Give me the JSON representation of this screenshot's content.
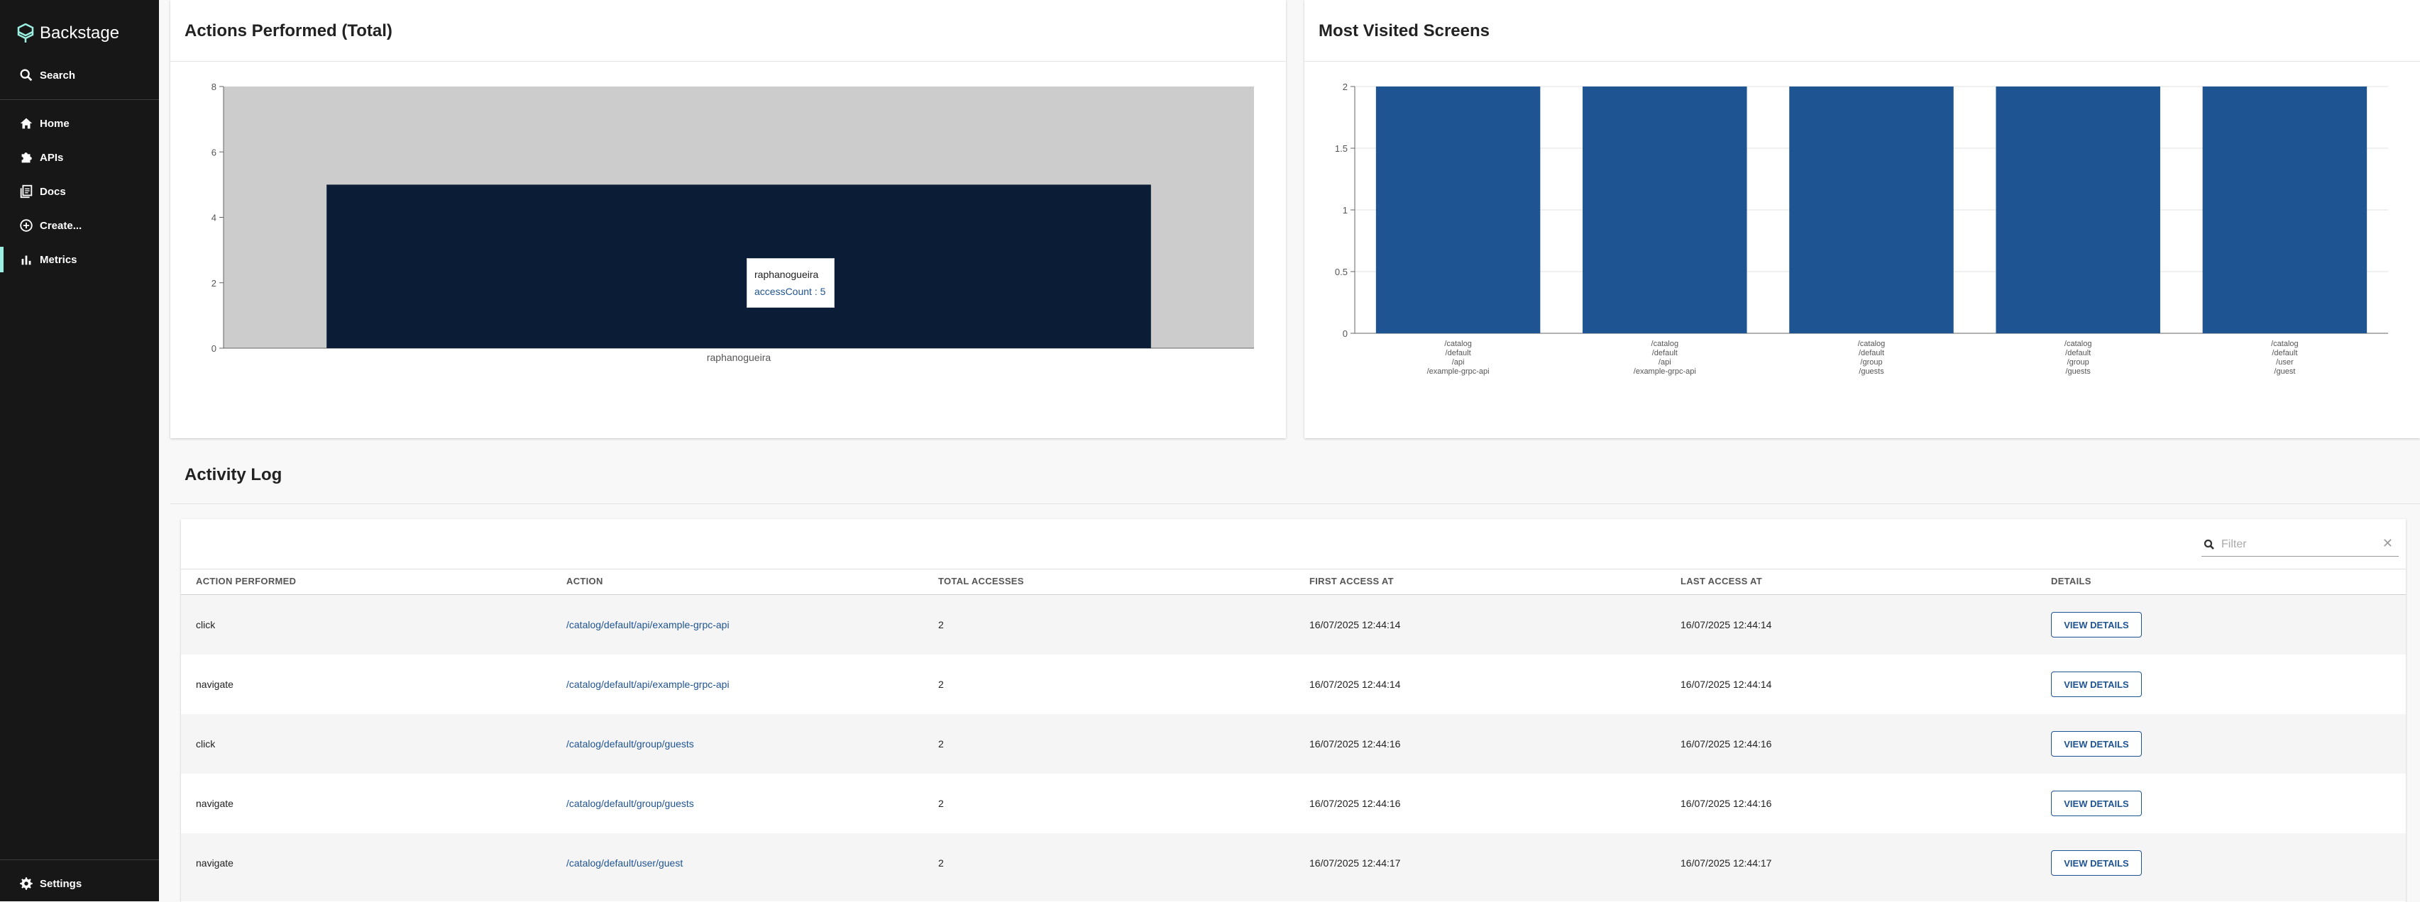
{
  "sidebar": {
    "logo_text": "Backstage",
    "items": [
      {
        "label": "Search",
        "icon": "search-icon"
      },
      {
        "label": "Home",
        "icon": "home-icon"
      },
      {
        "label": "APIs",
        "icon": "puzzle-icon"
      },
      {
        "label": "Docs",
        "icon": "docs-icon"
      },
      {
        "label": "Create...",
        "icon": "add-circle-icon"
      },
      {
        "label": "Metrics",
        "icon": "bar-chart-icon"
      }
    ],
    "settings_label": "Settings"
  },
  "actions_chart": {
    "title": "Actions Performed (Total)",
    "tooltip": {
      "name": "raphanogueira",
      "label": "accessCount",
      "value": "5"
    }
  },
  "visited_chart": {
    "title": "Most Visited Screens"
  },
  "chart_data": [
    {
      "type": "bar",
      "title": "Actions Performed (Total)",
      "categories": [
        "raphanogueira"
      ],
      "values": [
        5
      ],
      "ylim": [
        0,
        8
      ],
      "yticks": [
        0,
        2,
        4,
        6,
        8
      ],
      "xlabel": "",
      "ylabel": ""
    },
    {
      "type": "bar",
      "title": "Most Visited Screens",
      "categories": [
        "/catalog /default /api /example-grpc-api",
        "/catalog /default /api /example-grpc-api",
        "/catalog /default /group /guests",
        "/catalog /default /group /guests",
        "/catalog /default /user /guest"
      ],
      "category_lines": [
        [
          "/catalog",
          "/default",
          "/api",
          "/example-grpc-api"
        ],
        [
          "/catalog",
          "/default",
          "/api",
          "/example-grpc-api"
        ],
        [
          "/catalog",
          "/default",
          "/group",
          "/guests"
        ],
        [
          "/catalog",
          "/default",
          "/group",
          "/guests"
        ],
        [
          "/catalog",
          "/default",
          "/user",
          "/guest"
        ]
      ],
      "values": [
        2,
        2,
        2,
        2,
        2
      ],
      "ylim": [
        0,
        2
      ],
      "yticks": [
        0,
        0.5,
        1,
        1.5,
        2
      ],
      "yticklabels": [
        "0",
        "0.5",
        "1",
        "1.5",
        "2"
      ],
      "grid": true,
      "xlabel": "",
      "ylabel": ""
    }
  ],
  "activity_log": {
    "title": "Activity Log",
    "filter_placeholder": "Filter",
    "columns": [
      "ACTION PERFORMED",
      "ACTION",
      "TOTAL ACCESSES",
      "FIRST ACCESS AT",
      "LAST ACCESS AT",
      "DETAILS"
    ],
    "button_label": "VIEW DETAILS",
    "rows": [
      {
        "action_performed": "click",
        "action": "/catalog/default/api/example-grpc-api",
        "total": "2",
        "first": "16/07/2025 12:44:14",
        "last": "16/07/2025 12:44:14"
      },
      {
        "action_performed": "navigate",
        "action": "/catalog/default/api/example-grpc-api",
        "total": "2",
        "first": "16/07/2025 12:44:14",
        "last": "16/07/2025 12:44:14"
      },
      {
        "action_performed": "click",
        "action": "/catalog/default/group/guests",
        "total": "2",
        "first": "16/07/2025 12:44:16",
        "last": "16/07/2025 12:44:16"
      },
      {
        "action_performed": "navigate",
        "action": "/catalog/default/group/guests",
        "total": "2",
        "first": "16/07/2025 12:44:16",
        "last": "16/07/2025 12:44:16"
      },
      {
        "action_performed": "navigate",
        "action": "/catalog/default/user/guest",
        "total": "2",
        "first": "16/07/2025 12:44:17",
        "last": "16/07/2025 12:44:17"
      }
    ]
  },
  "colors": {
    "sidebar_bg": "#171717",
    "accent": "#9bf0e1",
    "actions_bar": "#0b1d36",
    "actions_plot_bg": "#cccccc",
    "visited_bar": "#1f5493",
    "link": "#1f5493"
  }
}
